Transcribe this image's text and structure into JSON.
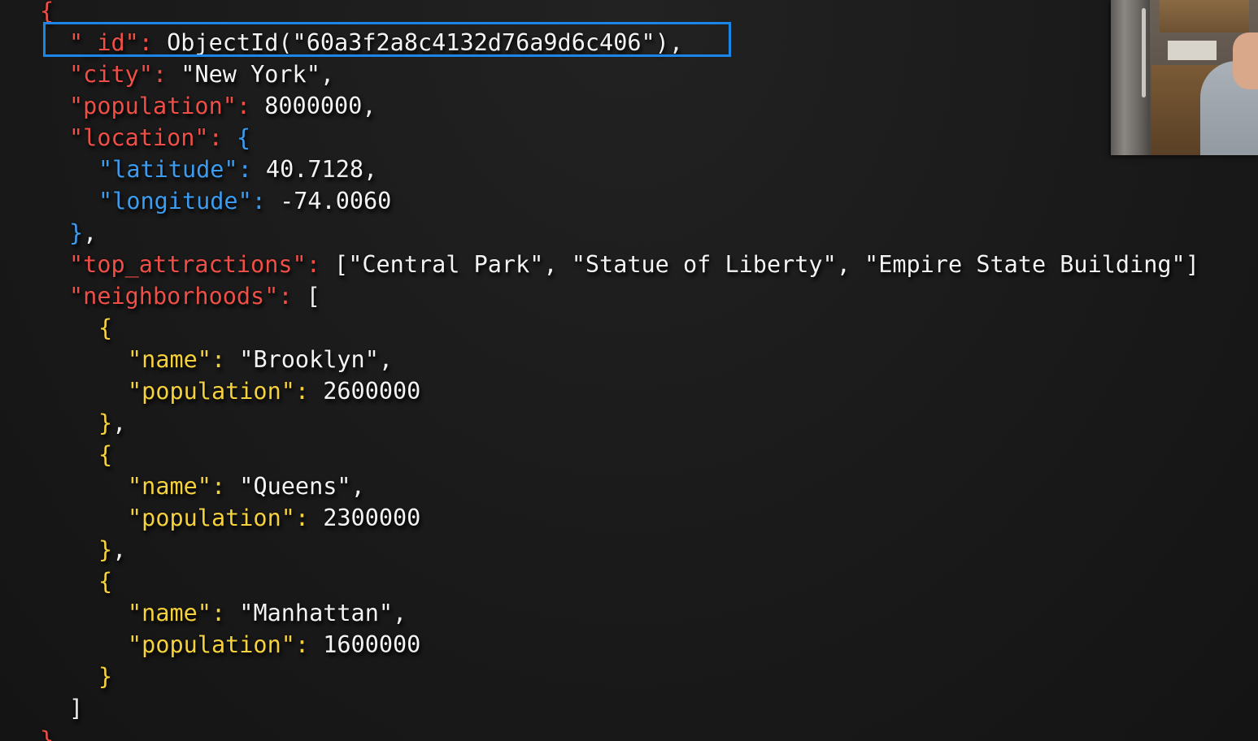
{
  "document": {
    "lines": [
      {
        "indent": 0,
        "tokens": [
          {
            "t": "{",
            "c": "br-r"
          }
        ]
      },
      {
        "indent": 1,
        "tokens": [
          {
            "t": "\"_id\"",
            "c": "kr"
          },
          {
            "t": ": ",
            "c": "kr"
          },
          {
            "t": "ObjectId(\"60a3f2a8c4132d76a9d6c406\")",
            "c": "v"
          },
          {
            "t": ",",
            "c": "p"
          }
        ]
      },
      {
        "indent": 1,
        "tokens": [
          {
            "t": "\"city\"",
            "c": "kr"
          },
          {
            "t": ": ",
            "c": "kr"
          },
          {
            "t": "\"New York\"",
            "c": "v"
          },
          {
            "t": ",",
            "c": "p"
          }
        ]
      },
      {
        "indent": 1,
        "tokens": [
          {
            "t": "\"population\"",
            "c": "kr"
          },
          {
            "t": ": ",
            "c": "kr"
          },
          {
            "t": "8000000",
            "c": "v"
          },
          {
            "t": ",",
            "c": "p"
          }
        ]
      },
      {
        "indent": 1,
        "tokens": [
          {
            "t": "\"location\"",
            "c": "kr"
          },
          {
            "t": ": ",
            "c": "kr"
          },
          {
            "t": "{",
            "c": "br-b"
          }
        ]
      },
      {
        "indent": 2,
        "tokens": [
          {
            "t": "\"latitude\"",
            "c": "kb"
          },
          {
            "t": ": ",
            "c": "kb"
          },
          {
            "t": "40.7128",
            "c": "v"
          },
          {
            "t": ",",
            "c": "p"
          }
        ]
      },
      {
        "indent": 2,
        "tokens": [
          {
            "t": "\"longitude\"",
            "c": "kb"
          },
          {
            "t": ": ",
            "c": "kb"
          },
          {
            "t": "-74.0060",
            "c": "v"
          }
        ]
      },
      {
        "indent": 1,
        "tokens": [
          {
            "t": "}",
            "c": "br-b"
          },
          {
            "t": ",",
            "c": "p"
          }
        ]
      },
      {
        "indent": 1,
        "tokens": [
          {
            "t": "\"top_attractions\"",
            "c": "kr"
          },
          {
            "t": ": ",
            "c": "kr"
          },
          {
            "t": "[\"Central Park\", \"Statue of Liberty\", \"Empire State Building\"]",
            "c": "v"
          }
        ]
      },
      {
        "indent": 1,
        "tokens": [
          {
            "t": "\"neighborhoods\"",
            "c": "kr"
          },
          {
            "t": ": ",
            "c": "kr"
          },
          {
            "t": "[",
            "c": "br-w"
          }
        ]
      },
      {
        "indent": 2,
        "tokens": [
          {
            "t": "{",
            "c": "br-y"
          }
        ]
      },
      {
        "indent": 3,
        "tokens": [
          {
            "t": "\"name\"",
            "c": "ky"
          },
          {
            "t": ": ",
            "c": "ky"
          },
          {
            "t": "\"Brooklyn\"",
            "c": "v"
          },
          {
            "t": ",",
            "c": "p"
          }
        ]
      },
      {
        "indent": 3,
        "tokens": [
          {
            "t": "\"population\"",
            "c": "ky"
          },
          {
            "t": ": ",
            "c": "ky"
          },
          {
            "t": "2600000",
            "c": "v"
          }
        ]
      },
      {
        "indent": 2,
        "tokens": [
          {
            "t": "}",
            "c": "br-y"
          },
          {
            "t": ",",
            "c": "p"
          }
        ]
      },
      {
        "indent": 2,
        "tokens": [
          {
            "t": "{",
            "c": "br-y"
          }
        ]
      },
      {
        "indent": 3,
        "tokens": [
          {
            "t": "\"name\"",
            "c": "ky"
          },
          {
            "t": ": ",
            "c": "ky"
          },
          {
            "t": "\"Queens\"",
            "c": "v"
          },
          {
            "t": ",",
            "c": "p"
          }
        ]
      },
      {
        "indent": 3,
        "tokens": [
          {
            "t": "\"population\"",
            "c": "ky"
          },
          {
            "t": ": ",
            "c": "ky"
          },
          {
            "t": "2300000",
            "c": "v"
          }
        ]
      },
      {
        "indent": 2,
        "tokens": [
          {
            "t": "}",
            "c": "br-y"
          },
          {
            "t": ",",
            "c": "p"
          }
        ]
      },
      {
        "indent": 2,
        "tokens": [
          {
            "t": "{",
            "c": "br-y"
          }
        ]
      },
      {
        "indent": 3,
        "tokens": [
          {
            "t": "\"name\"",
            "c": "ky"
          },
          {
            "t": ": ",
            "c": "ky"
          },
          {
            "t": "\"Manhattan\"",
            "c": "v"
          },
          {
            "t": ",",
            "c": "p"
          }
        ]
      },
      {
        "indent": 3,
        "tokens": [
          {
            "t": "\"population\"",
            "c": "ky"
          },
          {
            "t": ": ",
            "c": "ky"
          },
          {
            "t": "1600000",
            "c": "v"
          }
        ]
      },
      {
        "indent": 2,
        "tokens": [
          {
            "t": "}",
            "c": "br-y"
          }
        ]
      },
      {
        "indent": 1,
        "tokens": [
          {
            "t": "]",
            "c": "br-w"
          }
        ]
      },
      {
        "indent": 0,
        "tokens": [
          {
            "t": "}",
            "c": "br-r"
          }
        ]
      }
    ],
    "highlighted_line": 1
  },
  "colors": {
    "background": "#1a1a1a",
    "key_red": "#ef4f46",
    "key_blue": "#3c9cf0",
    "key_yellow": "#f5d13d",
    "value_white": "#f3f3f3",
    "highlight_border": "#1a86e8"
  },
  "webcam": {
    "icon": "webcam-video-feed"
  }
}
